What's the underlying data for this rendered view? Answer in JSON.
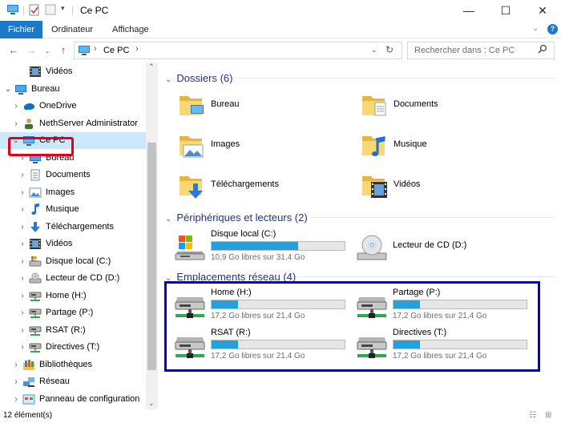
{
  "window": {
    "title": "Ce PC",
    "controls": {
      "minimize": "—",
      "maximize": "☐",
      "close": "✕"
    }
  },
  "ribbon": {
    "tabs": [
      {
        "label": "Fichier",
        "active": true
      },
      {
        "label": "Ordinateur",
        "active": false
      },
      {
        "label": "Affichage",
        "active": false
      }
    ]
  },
  "address": {
    "path": "Ce PC",
    "search_placeholder": "Rechercher dans : Ce PC"
  },
  "nav": {
    "items": [
      {
        "label": "Vidéos",
        "indent": 2,
        "expander": "",
        "icon": "videos-icon",
        "selected": false
      },
      {
        "label": "Bureau",
        "indent": 0,
        "expander": "⌄",
        "icon": "desktop-icon",
        "selected": false
      },
      {
        "label": "OneDrive",
        "indent": 1,
        "expander": "›",
        "icon": "cloud-icon",
        "selected": false
      },
      {
        "label": "NethServer Administrator",
        "indent": 1,
        "expander": "›",
        "icon": "user-icon",
        "selected": false
      },
      {
        "label": "Ce PC",
        "indent": 1,
        "expander": "⌄",
        "icon": "computer-icon",
        "selected": true
      },
      {
        "label": "Bureau",
        "indent": 2,
        "expander": "›",
        "icon": "desktop-icon",
        "selected": false
      },
      {
        "label": "Documents",
        "indent": 2,
        "expander": "›",
        "icon": "documents-icon",
        "selected": false
      },
      {
        "label": "Images",
        "indent": 2,
        "expander": "›",
        "icon": "images-icon",
        "selected": false
      },
      {
        "label": "Musique",
        "indent": 2,
        "expander": "›",
        "icon": "music-icon",
        "selected": false
      },
      {
        "label": "Téléchargements",
        "indent": 2,
        "expander": "›",
        "icon": "download-icon",
        "selected": false
      },
      {
        "label": "Vidéos",
        "indent": 2,
        "expander": "›",
        "icon": "videos-icon",
        "selected": false
      },
      {
        "label": "Disque local (C:)",
        "indent": 2,
        "expander": "›",
        "icon": "local-disk-icon",
        "selected": false
      },
      {
        "label": "Lecteur de CD (D:)",
        "indent": 2,
        "expander": "›",
        "icon": "cd-drive-icon",
        "selected": false
      },
      {
        "label": "Home (H:)",
        "indent": 2,
        "expander": "›",
        "icon": "network-drive-icon",
        "selected": false
      },
      {
        "label": "Partage (P:)",
        "indent": 2,
        "expander": "›",
        "icon": "network-drive-icon",
        "selected": false
      },
      {
        "label": "RSAT (R:)",
        "indent": 2,
        "expander": "›",
        "icon": "network-drive-icon",
        "selected": false
      },
      {
        "label": "Directives (T:)",
        "indent": 2,
        "expander": "›",
        "icon": "network-drive-icon",
        "selected": false
      },
      {
        "label": "Bibliothèques",
        "indent": 1,
        "expander": "›",
        "icon": "libraries-icon",
        "selected": false
      },
      {
        "label": "Réseau",
        "indent": 1,
        "expander": "›",
        "icon": "network-icon",
        "selected": false
      },
      {
        "label": "Panneau de configuration",
        "indent": 1,
        "expander": "›",
        "icon": "control-panel-icon",
        "selected": false
      }
    ]
  },
  "sections": {
    "folders": {
      "title": "Dossiers (6)",
      "items": [
        {
          "label": "Bureau",
          "icon": "desktop-folder-icon"
        },
        {
          "label": "Documents",
          "icon": "documents-folder-icon"
        },
        {
          "label": "Images",
          "icon": "images-folder-icon"
        },
        {
          "label": "Musique",
          "icon": "music-folder-icon"
        },
        {
          "label": "Téléchargements",
          "icon": "downloads-folder-icon"
        },
        {
          "label": "Vidéos",
          "icon": "videos-folder-icon"
        }
      ]
    },
    "devices": {
      "title": "Périphériques et lecteurs (2)",
      "items": [
        {
          "label": "Disque local (C:)",
          "free": "10,9 Go libres sur 31,4 Go",
          "used_fraction": 0.65,
          "icon": "local-disk-icon"
        },
        {
          "label": "Lecteur de CD (D:)",
          "free": "",
          "used_fraction": null,
          "icon": "cd-drive-icon"
        }
      ]
    },
    "network": {
      "title": "Emplacements réseau (4)",
      "items": [
        {
          "label": "Home (H:)",
          "free": "17,2 Go libres sur 21,4 Go",
          "used_fraction": 0.2,
          "icon": "network-drive-icon"
        },
        {
          "label": "Partage (P:)",
          "free": "17,2 Go libres sur 21,4 Go",
          "used_fraction": 0.2,
          "icon": "network-drive-icon"
        },
        {
          "label": "RSAT (R:)",
          "free": "17,2 Go libres sur 21,4 Go",
          "used_fraction": 0.2,
          "icon": "network-drive-icon"
        },
        {
          "label": "Directives (T:)",
          "free": "17,2 Go libres sur 21,4 Go",
          "used_fraction": 0.2,
          "icon": "network-drive-icon"
        }
      ]
    }
  },
  "status": {
    "count": "12 élément(s)"
  },
  "colors": {
    "accent": "#1979ca",
    "bar_fill": "#26a0da",
    "highlight_red": "#e0001b",
    "highlight_blue": "#0000d4",
    "selection": "#cce8ff"
  }
}
